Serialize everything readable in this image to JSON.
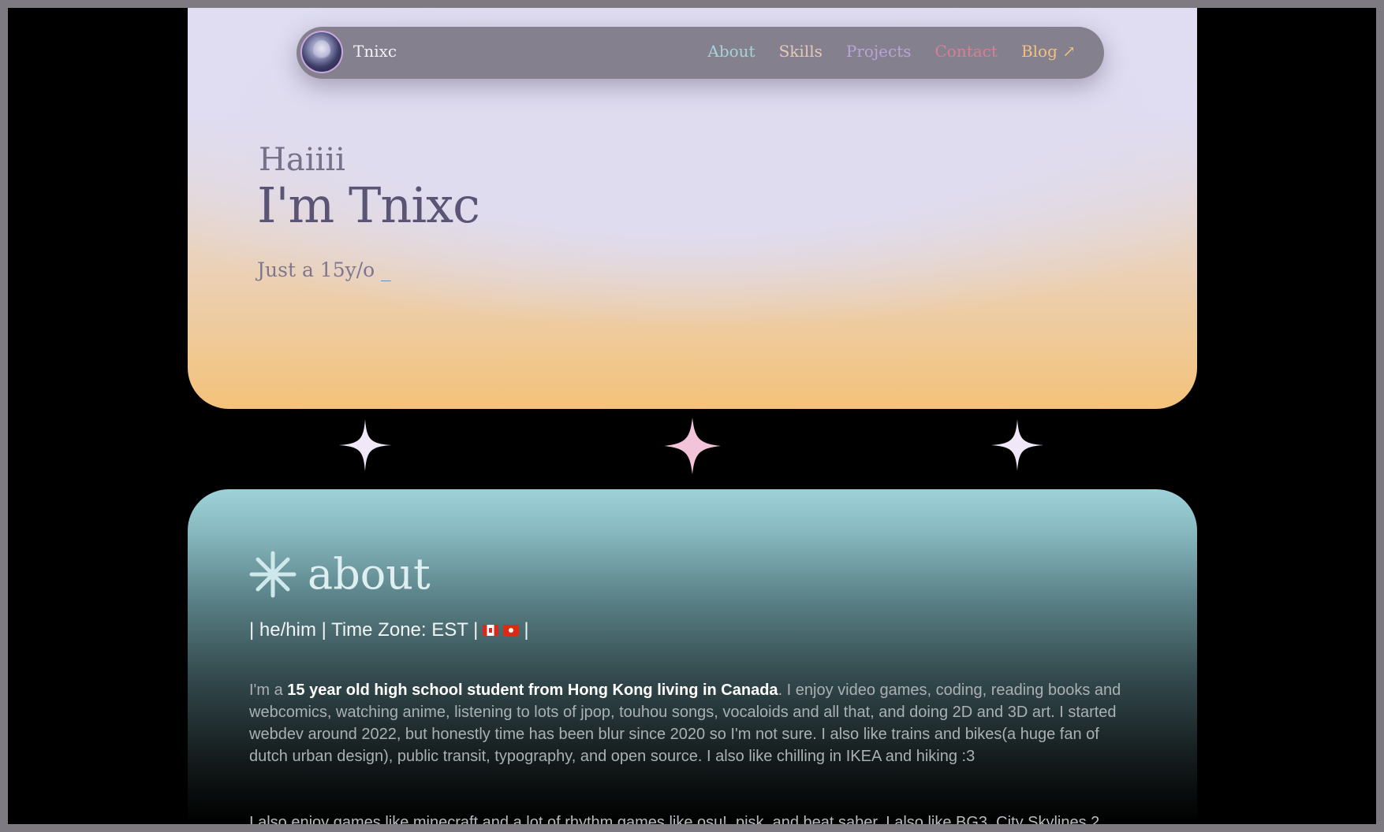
{
  "nav": {
    "brand": "Tnixc",
    "links": [
      {
        "label": "About",
        "color": "#a6d3d8"
      },
      {
        "label": "Skills",
        "color": "#e6c8b6"
      },
      {
        "label": "Projects",
        "color": "#b9a3d8"
      },
      {
        "label": "Contact",
        "color": "#d87f92"
      },
      {
        "label": "Blog ↗",
        "color": "#f1c27d"
      }
    ]
  },
  "hero": {
    "greeting": "Haiiii",
    "title": "I'm Tnixc",
    "subtitle": "Just a 15y/o",
    "cursor": "_"
  },
  "sparkles": [
    {
      "name": "sparkle-left",
      "color": "#f0e8f8"
    },
    {
      "name": "sparkle-center",
      "color": "#f3c3d9"
    },
    {
      "name": "sparkle-right",
      "color": "#f0e8f8"
    }
  ],
  "about": {
    "heading": "about",
    "meta_pronouns": "| he/him | Time Zone: EST |",
    "meta_end": "|",
    "p1_lead": "I'm a ",
    "p1_bold": "15 year old high school student from Hong Kong living in Canada",
    "p1_rest": ". I enjoy video games, coding, reading books and webcomics, watching anime, listening to lots of jpop, touhou songs, vocaloids and all that, and doing 2D and 3D art. I started webdev around 2022, but honestly time has been blur since 2020 so I'm not sure. I also like trains and bikes(a huge fan of dutch urban design), public transit, typography, and open source. I also like chilling in IKEA and hiking :3",
    "p2": "I also enjoy games like minecraft and a lot of rhythm games like osu!, pjsk, and beat saber. I also like BG3, City Skylines 2, Cyberpunk, poly bridge, ultrakill, besiege, and celeste"
  }
}
